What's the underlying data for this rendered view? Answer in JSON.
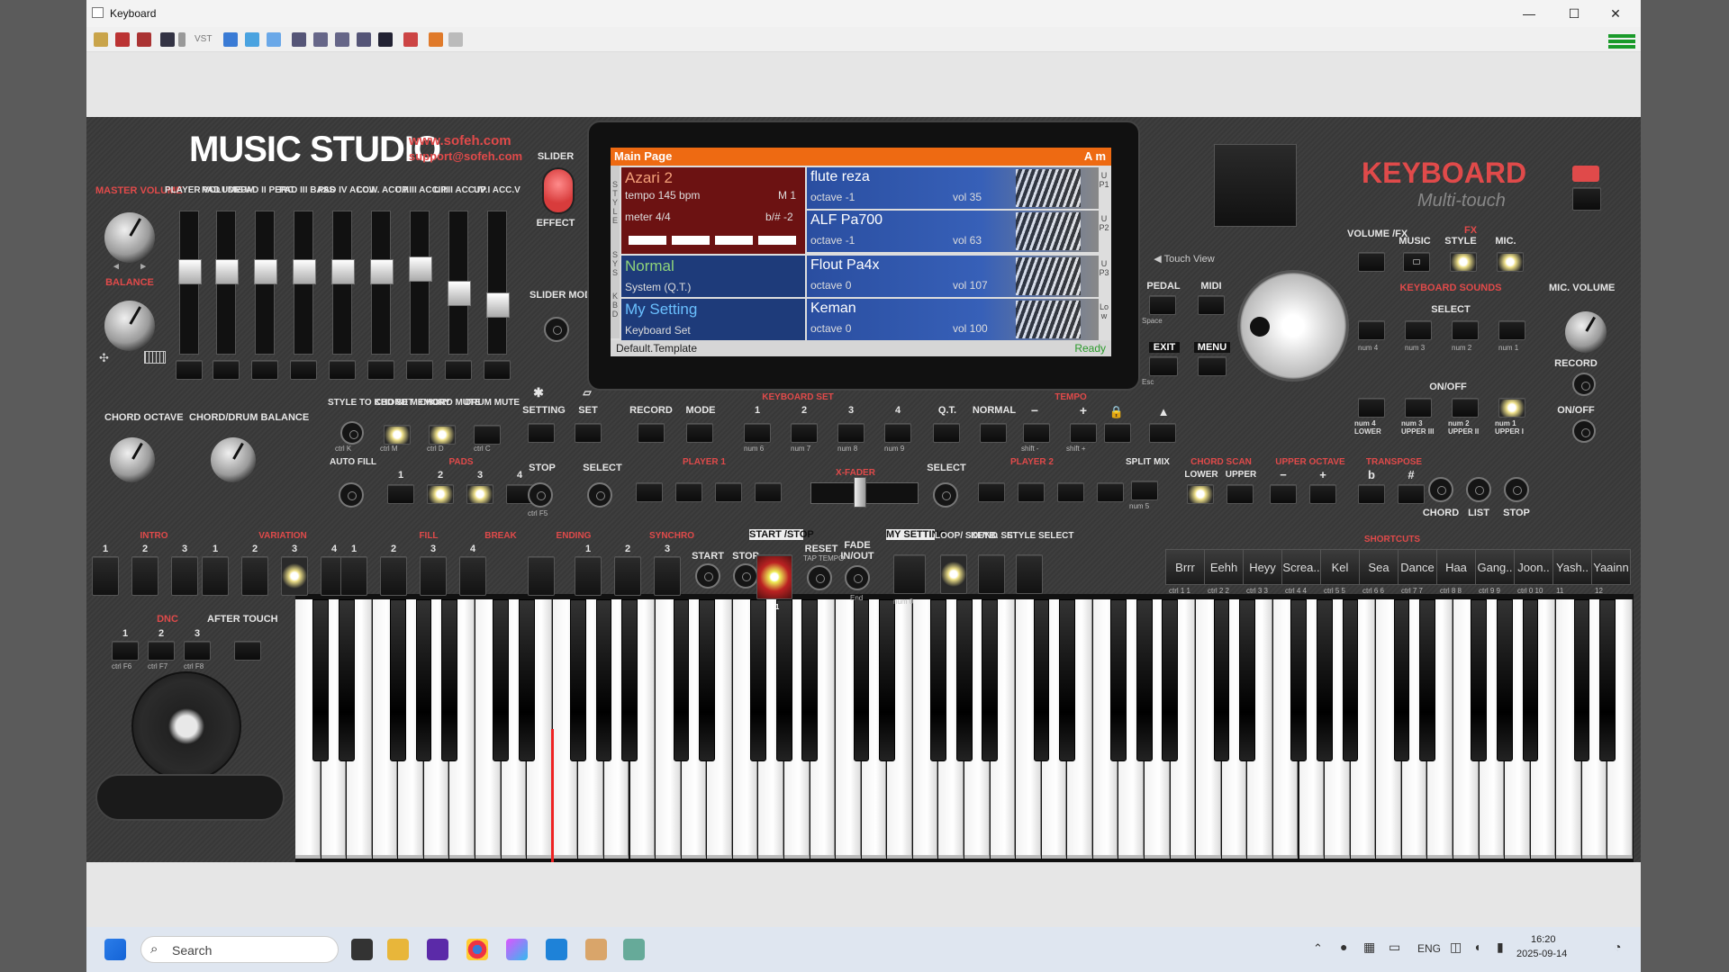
{
  "window": {
    "title": "Keyboard",
    "controls": [
      "—",
      "☐",
      "✕"
    ]
  },
  "toolbar": {
    "vst_label": "VST",
    "icons": [
      "open-icon",
      "styles-icon",
      "yamaha-icon",
      "save-icon",
      "dropdown-icon",
      "vst-icon",
      "network-icon",
      "link-icon",
      "window-icon",
      "mixer-icon",
      "piano-roll-icon",
      "tracks-icon",
      "chart-icon",
      "layout-icon",
      "midi-icon",
      "refresh-icon",
      "settings-icon"
    ]
  },
  "brand": {
    "title": "MUSIC STUDIO",
    "url": "www.sofeh.com",
    "email": "support@sofeh.com",
    "product": "KEYBOARD",
    "subtitle": "Multi-touch"
  },
  "left": {
    "master_volume": "MASTER VOLUME",
    "balance": "BALANCE",
    "chord_octave": "CHORD OCTAVE",
    "chord_drum_balance": "CHORD/DRUM BALANCE"
  },
  "sliders": [
    {
      "label": "PLAYER VOLUME",
      "level": 0.6
    },
    {
      "label": "PAD I DRUM",
      "level": 0.6
    },
    {
      "label": "PAD II PERC.",
      "level": 0.6
    },
    {
      "label": "PAD III BASS",
      "level": 0.6
    },
    {
      "label": "PAD IV ACC.I",
      "level": 0.6
    },
    {
      "label": "LOW. ACC.II",
      "level": 0.6
    },
    {
      "label": "UP.III ACC.III",
      "level": 0.62
    },
    {
      "label": "UP.II ACC.IV",
      "level": 0.42
    },
    {
      "label": "UP.I ACC.V",
      "level": 0.32
    }
  ],
  "slider_block": {
    "slider": "SLIDER",
    "effect": "EFFECT",
    "slider_mode": "SLIDER MODE"
  },
  "display": {
    "header": "Main Page",
    "key": "A m",
    "style_name": "Azari 2",
    "tempo": "tempo 145 bpm",
    "measure": "M 1",
    "meter": "meter 4/4",
    "transpose": "b/# -2",
    "sys_name": "Normal",
    "sys_sub": "System (Q.T.)",
    "kbd_name": "My Setting",
    "kbd_sub": "Keyboard Set",
    "side_labels": {
      "style": "STYLE",
      "sys": "SYS",
      "kbd": "KBD"
    },
    "sounds": [
      {
        "name": "flute reza",
        "octave": "octave -1",
        "vol": "vol 35",
        "tag": "UP1"
      },
      {
        "name": "ALF Pa700",
        "octave": "octave -1",
        "vol": "vol 63",
        "tag": "UP2"
      },
      {
        "name": "Flout Pa4x",
        "octave": "octave 0",
        "vol": "vol 107",
        "tag": "UP3"
      },
      {
        "name": "Keman",
        "octave": "octave 0",
        "vol": "vol 100",
        "tag": "Low"
      }
    ],
    "footer": "Default.Template",
    "status": "Ready"
  },
  "right_top": {
    "touch_view": "Touch View",
    "pedal": "PEDAL",
    "space": "Space",
    "midi": "MIDI",
    "exit": "EXIT",
    "esc": "Esc",
    "menu": "MENU",
    "volume_fx": "VOLUME /FX",
    "fx": "FX",
    "music": "MUSIC",
    "style": "STYLE",
    "mic": "MIC.",
    "mic_volume": "MIC. VOLUME",
    "keyboard_sounds": "KEYBOARD SOUNDS",
    "select": "SELECT",
    "on_off": "ON/OFF",
    "record": "RECORD",
    "on_off2": "ON/OFF",
    "ks_keys": [
      "num 4",
      "num 3",
      "num 2",
      "num 1"
    ],
    "lower_keys": [
      "num 4 LOWER",
      "num 3 UPPER III",
      "num 2 UPPER II",
      "num 1 UPPER I"
    ]
  },
  "mid": {
    "style_to_kbd": "STYLE TO KBD SET",
    "chord_memory": "CHORD MEMORY",
    "chord_mute": "CHORD MUTE",
    "drum_mute": "DRUM MUTE",
    "setting": "SETTING",
    "set": "SET",
    "record": "RECORD",
    "mode": "MODE",
    "keyboard_set": "KEYBOARD SET",
    "qt": "Q.T.",
    "normal": "NORMAL",
    "tempo": "TEMPO",
    "minus": "−",
    "plus": "+",
    "auto_fill": "AUTO FILL",
    "pads": "PADS",
    "stop": "STOP",
    "player1": "PLAYER 1",
    "xfader": "X-FADER",
    "player2": "PLAYER 2",
    "select": "SELECT",
    "split_mix": "SPLIT MIX",
    "chord_scan": "CHORD SCAN",
    "lower": "LOWER",
    "upper": "UPPER",
    "upper_octave": "UPPER OCTAVE",
    "transpose": "TRANSPOSE",
    "flat": "b",
    "sharp": "#",
    "chord": "CHORD",
    "list": "LIST",
    "stop2": "STOP",
    "ctrl_k": "ctrl K",
    "ctrl_m": "ctrl M",
    "ctrl_d": "ctrl D",
    "ctrl_c": "ctrl C",
    "ctrl_f5": "ctrl F5",
    "kbd_nums": [
      "1",
      "2",
      "3",
      "4"
    ],
    "kbd_keys": [
      "num 6",
      "num 7",
      "num 8",
      "num 9"
    ],
    "shift_minus": "shift -",
    "shift_plus": "shift +",
    "num5": "num 5"
  },
  "row4": {
    "intro": "INTRO",
    "variation": "VARIATION",
    "fill": "FILL",
    "break": "BREAK",
    "ending": "ENDING",
    "synchro": "SYNCHRO",
    "start": "START",
    "stop": "STOP",
    "start_stop": "START /STOP",
    "reset": "RESET",
    "tap_tempo": "TAP TEMPO",
    "fade": "FADE",
    "in_out": "IN/OUT",
    "end": "End",
    "my_setting": "MY SETTING",
    "loop_sound": "LOOP/ SOUND",
    "keyb_set": "KEYB. SET",
    "style_select": "STYLE SELECT",
    "shortcuts": "SHORTCUTS",
    "f1": "F1",
    "num0": "num 0",
    "ones": [
      "1",
      "2",
      "3"
    ],
    "fours": [
      "1",
      "2",
      "3",
      "4"
    ]
  },
  "shortcuts": [
    {
      "label": "Brrr",
      "key": "ctrl 1 1"
    },
    {
      "label": "Eehh",
      "key": "ctrl 2 2"
    },
    {
      "label": "Heyy",
      "key": "ctrl 3 3"
    },
    {
      "label": "Screa..",
      "key": "ctrl 4 4"
    },
    {
      "label": "Kel",
      "key": "ctrl 5 5"
    },
    {
      "label": "Sea",
      "key": "ctrl 6 6"
    },
    {
      "label": "Dance",
      "key": "ctrl 7 7"
    },
    {
      "label": "Haa",
      "key": "ctrl 8 8"
    },
    {
      "label": "Gang..",
      "key": "ctrl 9 9"
    },
    {
      "label": "Joon..",
      "key": "ctrl 0 10"
    },
    {
      "label": "Yash..",
      "key": "11"
    },
    {
      "label": "Yaainn",
      "key": "12"
    }
  ],
  "bottom_left": {
    "dnc": "DNC",
    "after_touch": "AFTER TOUCH",
    "dnc_nums": [
      "1",
      "2",
      "3"
    ],
    "dnc_keys": [
      "ctrl F6",
      "ctrl F7",
      "ctrl F8"
    ]
  },
  "taskbar": {
    "search_placeholder": "Search",
    "lang": "ENG",
    "time": "16:20",
    "date": "2025-09-14"
  }
}
